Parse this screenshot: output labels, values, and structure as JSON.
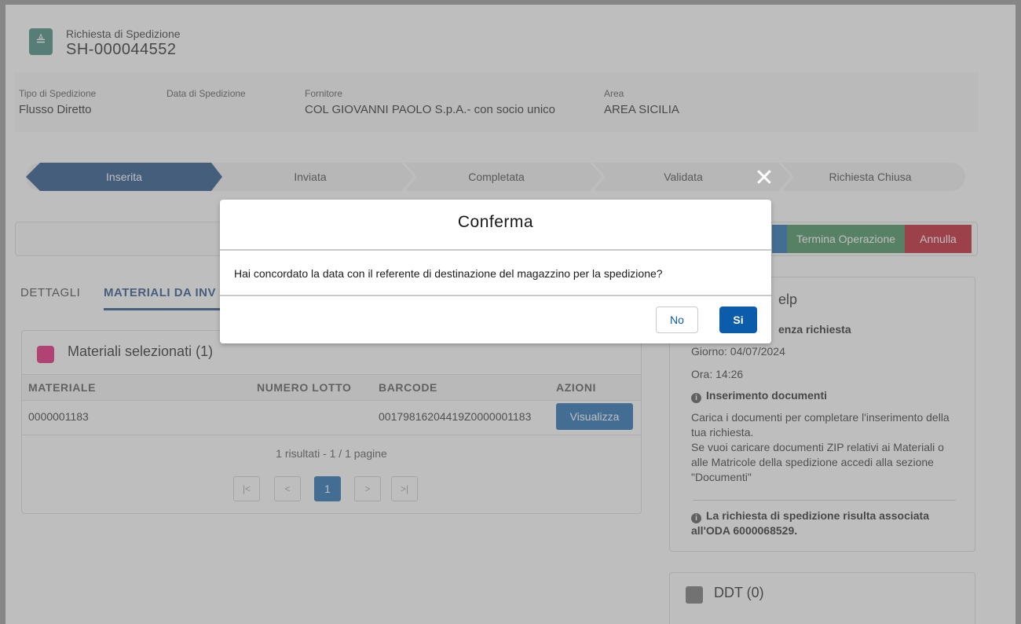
{
  "header": {
    "subtitle": "Richiesta di Spedizione",
    "title": "SH-000044552"
  },
  "fields": [
    {
      "label": "Tipo di Spedizione",
      "value": "Flusso Diretto"
    },
    {
      "label": "Data di Spedizione",
      "value": ""
    },
    {
      "label": "Fornitore",
      "value": "COL GIOVANNI PAOLO S.p.A.- con socio unico"
    },
    {
      "label": "Area",
      "value": "AREA SICILIA"
    }
  ],
  "path": [
    "Inserita",
    "Inviata",
    "Completata",
    "Validata",
    "Richiesta Chiusa"
  ],
  "actions": {
    "terminate": "Termina Operazione",
    "cancel": "Annulla"
  },
  "tabs": [
    "DETTAGLI",
    "MATERIALI DA INV"
  ],
  "materials": {
    "title": "Materiali selezionati (1)",
    "columns": [
      "MATERIALE",
      "NUMERO LOTTO",
      "BARCODE",
      "AZIONI"
    ],
    "rows": [
      {
        "materiale": "0000001183",
        "lotto": "",
        "barcode": "00179816204419Z0000001183",
        "action": "Visualizza"
      }
    ],
    "page_info": "1 risultati - 1 / 1 pagine",
    "pager": [
      "|<",
      "<",
      "1",
      ">",
      ">|"
    ]
  },
  "help": {
    "title": "elp",
    "deadline_title": "enza richiesta",
    "day": "Giorno: 04/07/2024",
    "time": "Ora: 14:26",
    "docs_title": "Inserimento documenti",
    "docs_lines": [
      "Carica i documenti per completare l'inserimento della",
      "tua richiesta.",
      "Se vuoi caricare documenti ZIP relativi ai Materiali o",
      "alle Matricole della spedizione accedi alla sezione",
      "\"Documenti\""
    ],
    "oda_line1": "La richiesta di spedizione risulta associata",
    "oda_line2": "all'ODA 6000068529."
  },
  "ddt": {
    "title": "DDT (0)"
  },
  "modal": {
    "title": "Conferma",
    "message": "Hai concordato la data con il referente di destinazione del magazzino per la spedizione?",
    "no": "No",
    "yes": "Si"
  },
  "icons": {
    "info": "i",
    "close": "✕",
    "record": "≜"
  }
}
